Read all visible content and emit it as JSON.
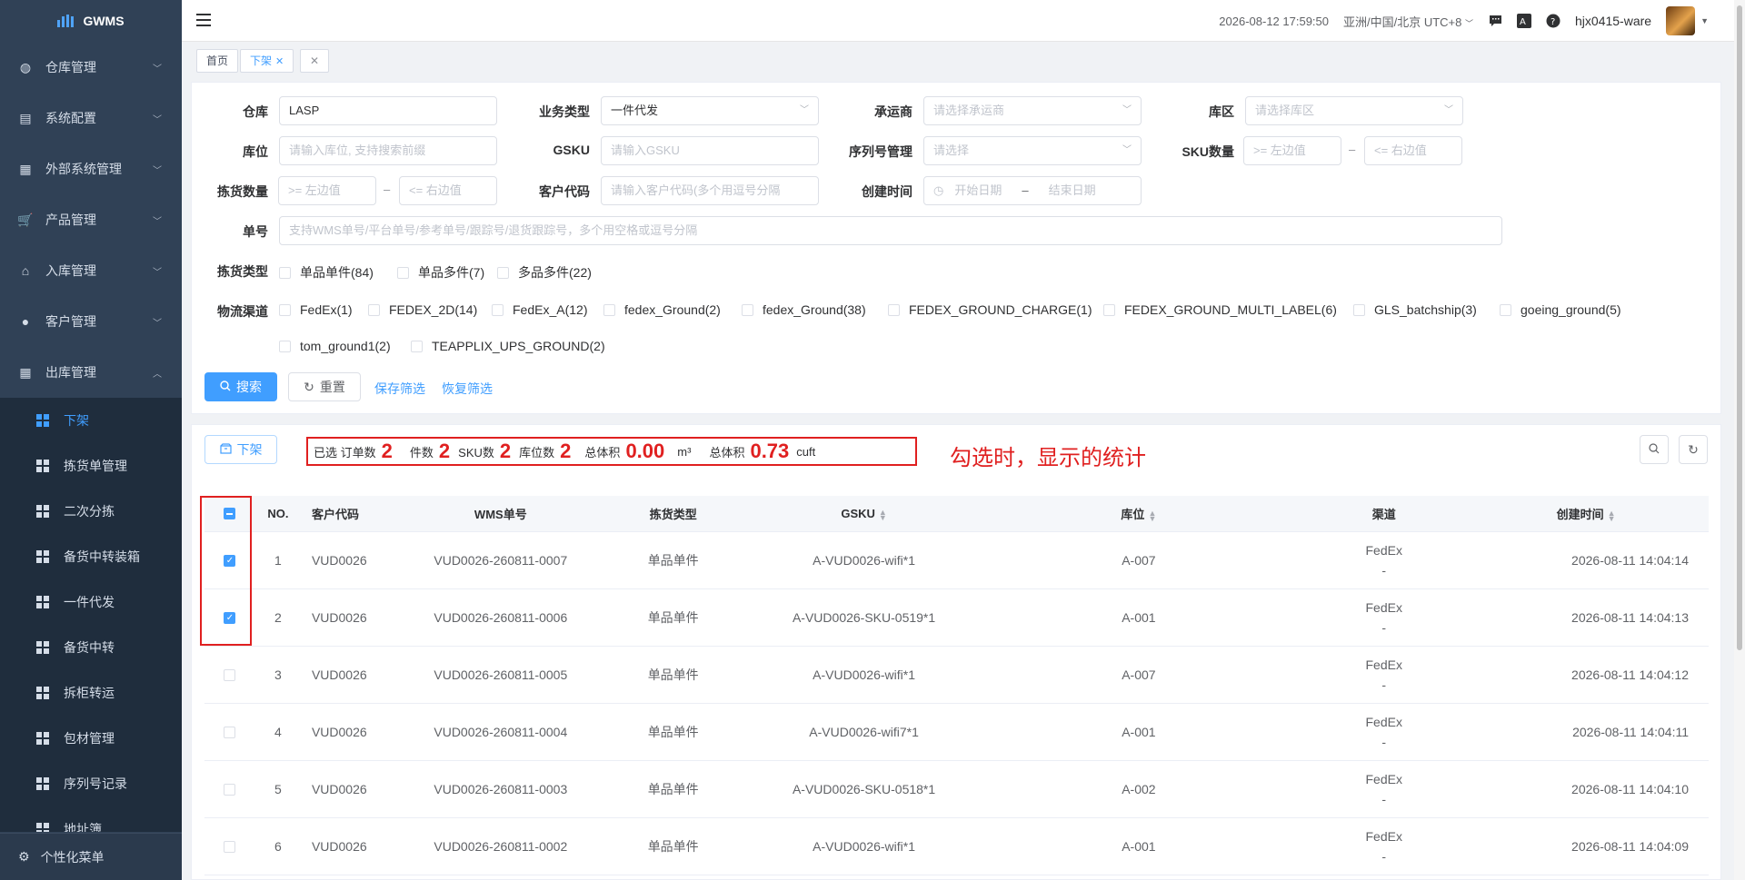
{
  "app": {
    "name": "GWMS"
  },
  "sidebar": {
    "menus": [
      {
        "label": "仓库管理",
        "icon": "globe-icon"
      },
      {
        "label": "系统配置",
        "icon": "server-icon"
      },
      {
        "label": "外部系统管理",
        "icon": "grid-icon"
      },
      {
        "label": "产品管理",
        "icon": "cart-icon"
      },
      {
        "label": "入库管理",
        "icon": "home-icon"
      },
      {
        "label": "客户管理",
        "icon": "user-icon"
      },
      {
        "label": "出库管理",
        "icon": "grid-icon"
      }
    ],
    "sub_items": [
      "下架",
      "拣货单管理",
      "二次分拣",
      "备货中转装箱",
      "一件代发",
      "备货中转",
      "拆柜转运",
      "包材管理",
      "序列号记录",
      "地址簿"
    ],
    "footer": "个性化菜单"
  },
  "header": {
    "datetime": "2026-08-12 17:59:50",
    "timezone": "亚洲/中国/北京 UTC+8",
    "username": "hjx0415-ware"
  },
  "tags": {
    "home": "首页",
    "current": "下架"
  },
  "filters": {
    "warehouse": {
      "label": "仓库",
      "value": "LASP"
    },
    "biz_type": {
      "label": "业务类型",
      "value": "一件代发"
    },
    "carrier": {
      "label": "承运商",
      "placeholder": "请选择承运商"
    },
    "zone": {
      "label": "库区",
      "placeholder": "请选择库区"
    },
    "location": {
      "label": "库位",
      "placeholder": "请输入库位, 支持搜索前缀"
    },
    "gsku": {
      "label": "GSKU",
      "placeholder": "请输入GSKU"
    },
    "serial": {
      "label": "序列号管理",
      "placeholder": "请选择"
    },
    "sku_qty": {
      "label": "SKU数量",
      "min_placeholder": ">= 左边值",
      "max_placeholder": "<= 右边值"
    },
    "pick_qty": {
      "label": "拣货数量",
      "min_placeholder": ">= 左边值",
      "max_placeholder": "<= 右边值"
    },
    "customer_code": {
      "label": "客户代码",
      "placeholder": "请输入客户代码(多个用逗号分隔"
    },
    "created": {
      "label": "创建时间",
      "start_placeholder": "开始日期",
      "sep": "–",
      "end_placeholder": "结束日期"
    },
    "order_no": {
      "label": "单号",
      "placeholder": "支持WMS单号/平台单号/参考单号/跟踪号/退货跟踪号，多个用空格或逗号分隔"
    },
    "pick_type": {
      "label": "拣货类型",
      "options": [
        "单品单件(84)",
        "单品多件(7)",
        "多品多件(22)"
      ]
    },
    "channel": {
      "label": "物流渠道",
      "options": [
        "FedEx(1)",
        "FEDEX_2D(14)",
        "FedEx_A(12)",
        "fedex_Ground(2)",
        "fedex_Ground(38)",
        "FEDEX_GROUND_CHARGE(1)",
        "FEDEX_GROUND_MULTI_LABEL(6)",
        "GLS_batchship(3)",
        "goeing_ground(5)",
        "tom_ground1(2)",
        "TEAPPLIX_UPS_GROUND(2)"
      ]
    },
    "range_sep": "–"
  },
  "actions": {
    "search": "搜索",
    "reset": "重置",
    "save_filter": "保存筛选",
    "restore_filter": "恢复筛选"
  },
  "toolbar": {
    "offshelf": "下架"
  },
  "stats": {
    "selected": "已选",
    "orders_label": "订单数",
    "orders": "2",
    "pieces_label": "件数",
    "pieces": "2",
    "sku_label": "SKU数",
    "sku": "2",
    "loc_label": "库位数",
    "loc": "2",
    "vol1_label": "总体积",
    "vol1": "0.00",
    "vol1_unit": "m³",
    "vol2_label": "总体积",
    "vol2": "0.73",
    "vol2_unit": "cuft"
  },
  "annotation": "勾选时，显示的统计",
  "table": {
    "headers": [
      "NO.",
      "客户代码",
      "WMS单号",
      "拣货类型",
      "GSKU",
      "库位",
      "渠道",
      "创建时间"
    ],
    "rows": [
      {
        "no": "1",
        "customer": "VUD0026",
        "wms": "VUD0026-260811-0007",
        "type": "单品单件",
        "gsku": "A-VUD0026-wifi*1",
        "loc": "A-007",
        "channel": "FedEx",
        "channel2": "-",
        "created": "2026-08-11 14:04:14",
        "checked": true
      },
      {
        "no": "2",
        "customer": "VUD0026",
        "wms": "VUD0026-260811-0006",
        "type": "单品单件",
        "gsku": "A-VUD0026-SKU-0519*1",
        "loc": "A-001",
        "channel": "FedEx",
        "channel2": "-",
        "created": "2026-08-11 14:04:13",
        "checked": true
      },
      {
        "no": "3",
        "customer": "VUD0026",
        "wms": "VUD0026-260811-0005",
        "type": "单品单件",
        "gsku": "A-VUD0026-wifi*1",
        "loc": "A-007",
        "channel": "FedEx",
        "channel2": "-",
        "created": "2026-08-11 14:04:12",
        "checked": false
      },
      {
        "no": "4",
        "customer": "VUD0026",
        "wms": "VUD0026-260811-0004",
        "type": "单品单件",
        "gsku": "A-VUD0026-wifi7*1",
        "loc": "A-001",
        "channel": "FedEx",
        "channel2": "-",
        "created": "2026-08-11 14:04:11",
        "checked": false
      },
      {
        "no": "5",
        "customer": "VUD0026",
        "wms": "VUD0026-260811-0003",
        "type": "单品单件",
        "gsku": "A-VUD0026-SKU-0518*1",
        "loc": "A-002",
        "channel": "FedEx",
        "channel2": "-",
        "created": "2026-08-11 14:04:10",
        "checked": false
      },
      {
        "no": "6",
        "customer": "VUD0026",
        "wms": "VUD0026-260811-0002",
        "type": "单品单件",
        "gsku": "A-VUD0026-wifi*1",
        "loc": "A-001",
        "channel": "FedEx",
        "channel2": "-",
        "created": "2026-08-11 14:04:09",
        "checked": false
      }
    ]
  },
  "colors": {
    "primary": "#409eff",
    "sidebar": "#304156",
    "highlight": "#e02020"
  }
}
